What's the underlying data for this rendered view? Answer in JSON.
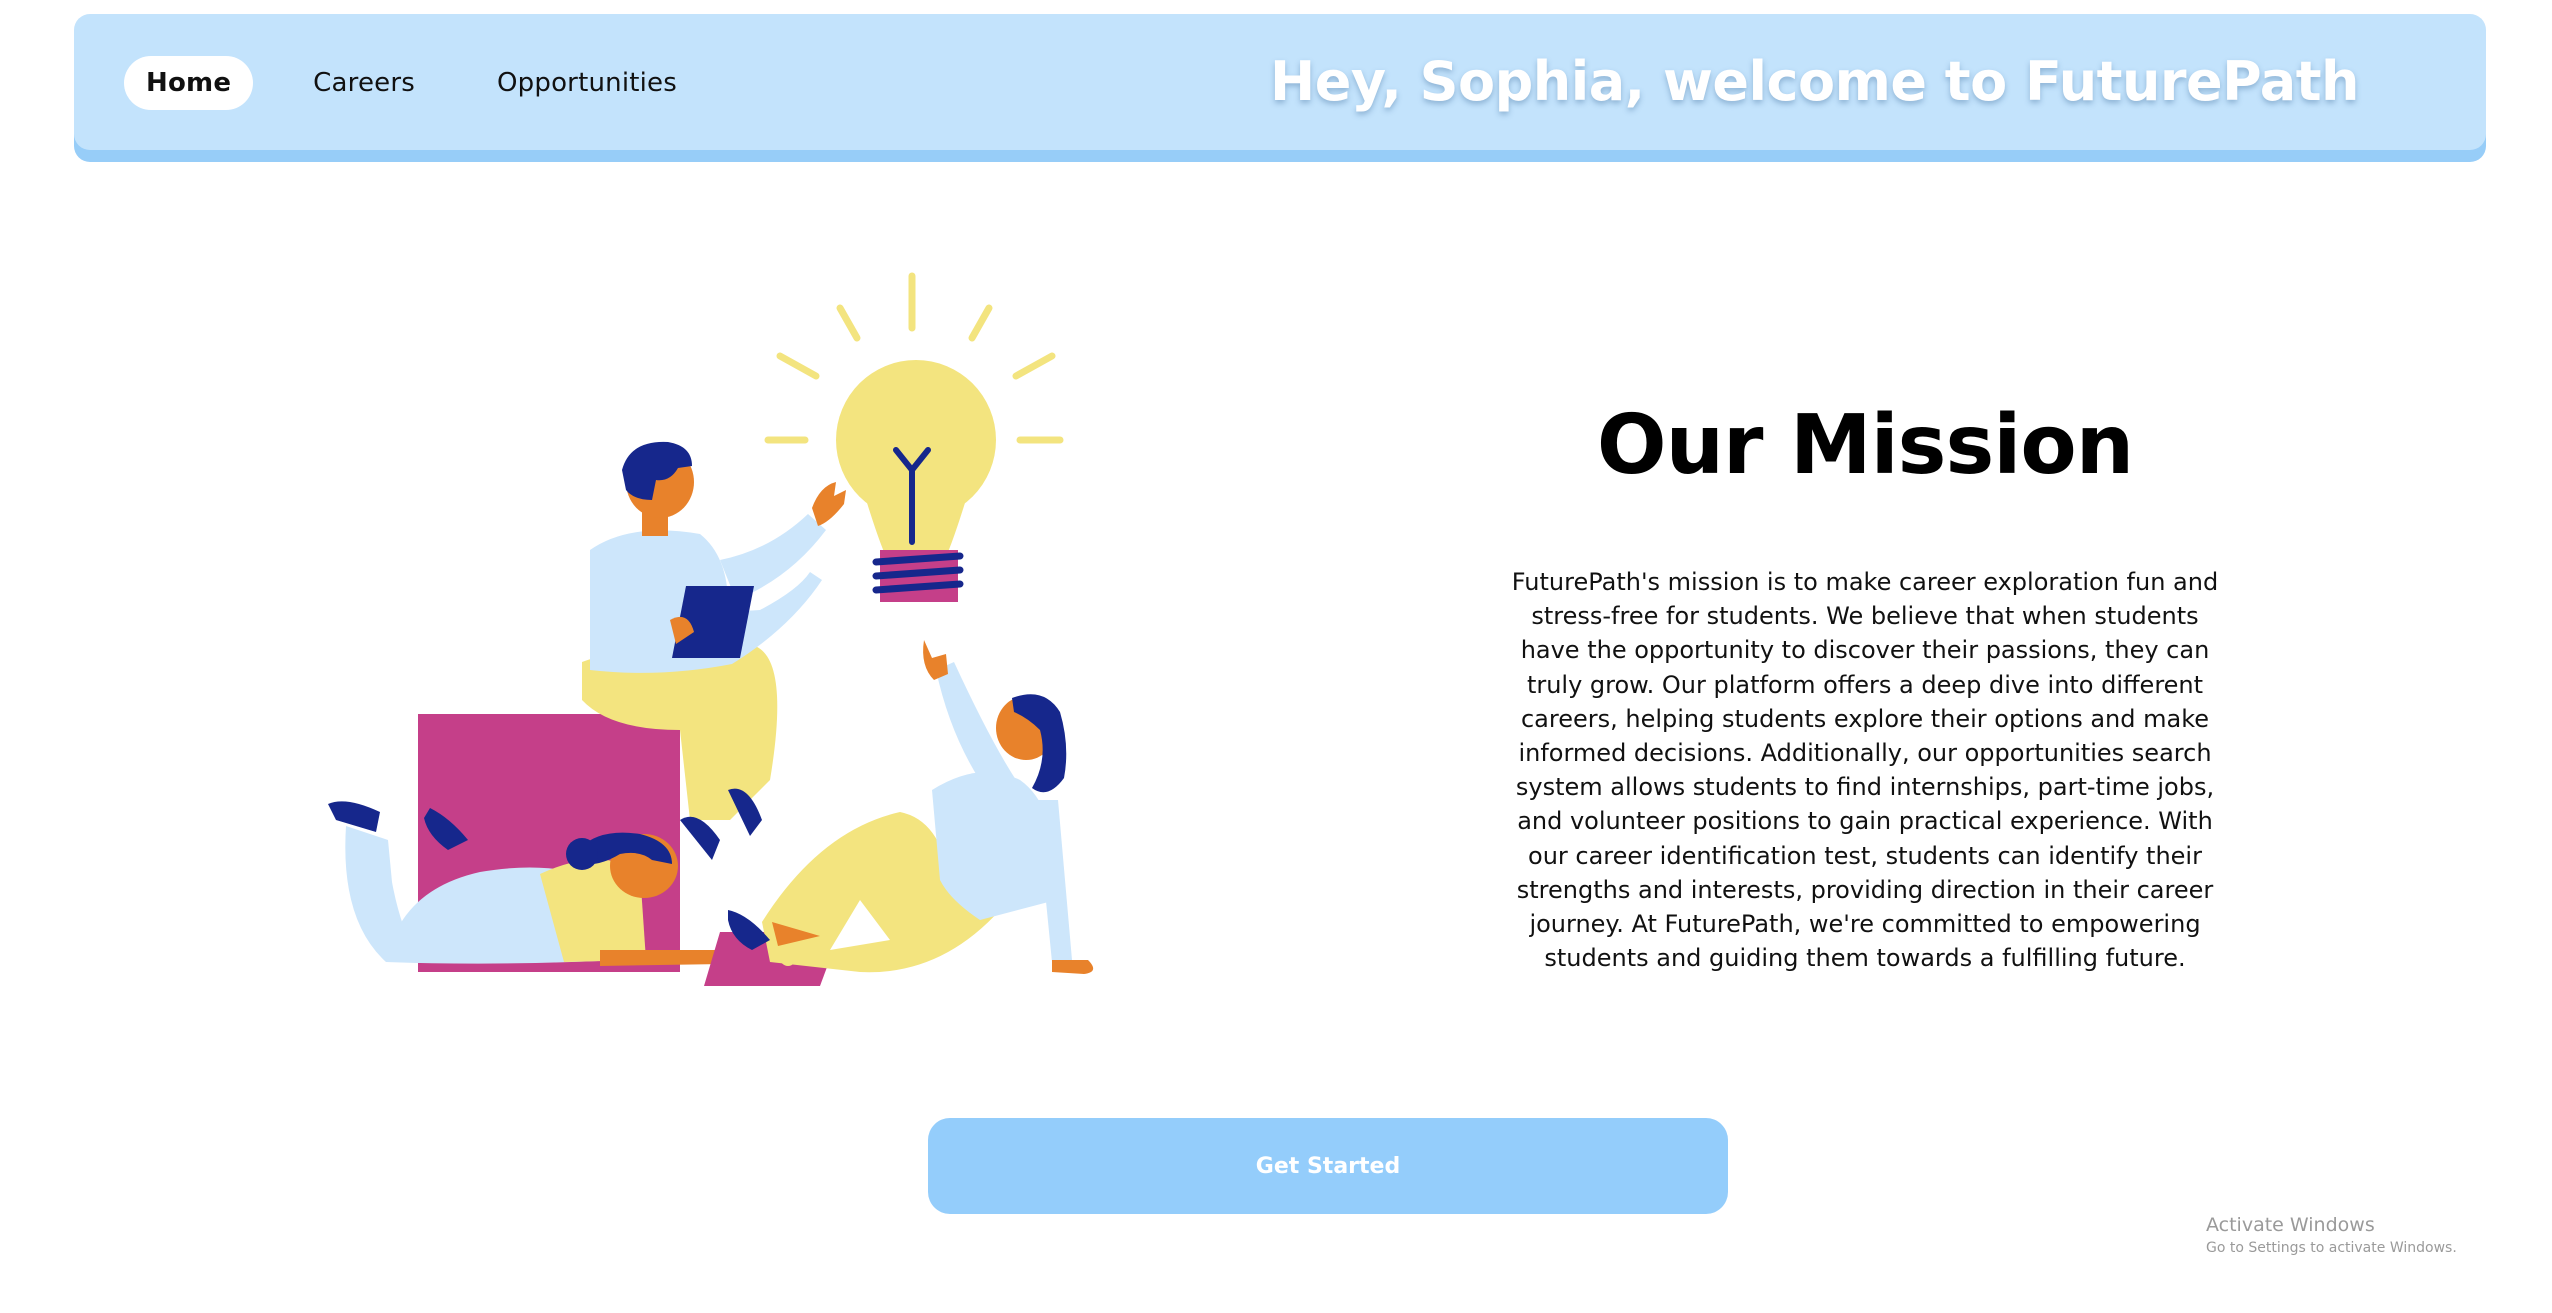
{
  "nav": {
    "items": [
      {
        "label": "Home",
        "active": true
      },
      {
        "label": "Careers",
        "active": false
      },
      {
        "label": "Opportunities",
        "active": false
      }
    ],
    "welcome": "Hey, Sophia, welcome to FuturePath"
  },
  "mission": {
    "title": "Our Mission",
    "body": "FuturePath's mission is to make career exploration fun and stress-free for students. We believe that when students have the opportunity to discover their passions, they can truly grow. Our platform offers a deep dive into different careers, helping students explore their options and make informed decisions. Additionally, our opportunities search system allows students to find internships, part-time jobs, and volunteer positions to gain practical experience. With our career identification test, students can identify their strengths and interests, providing direction in their career journey. At FuturePath, we're committed to empowering students and guiding them towards a fulfilling future."
  },
  "cta": {
    "label": "Get Started"
  },
  "watermark": {
    "title": "Activate Windows",
    "subtitle": "Go to Settings to activate Windows."
  },
  "colors": {
    "nav_bg": "#c3e3fc",
    "nav_shadow": "#97cdf8",
    "button_bg": "#94cdfb",
    "bulb_yellow": "#f3e47f",
    "magenta": "#c53f89",
    "navy": "#16278c",
    "skin": "#e8822b",
    "shirt_blue": "#cde6fb"
  },
  "illustration": {
    "icon": "team-ideas-lightbulb-illustration"
  }
}
